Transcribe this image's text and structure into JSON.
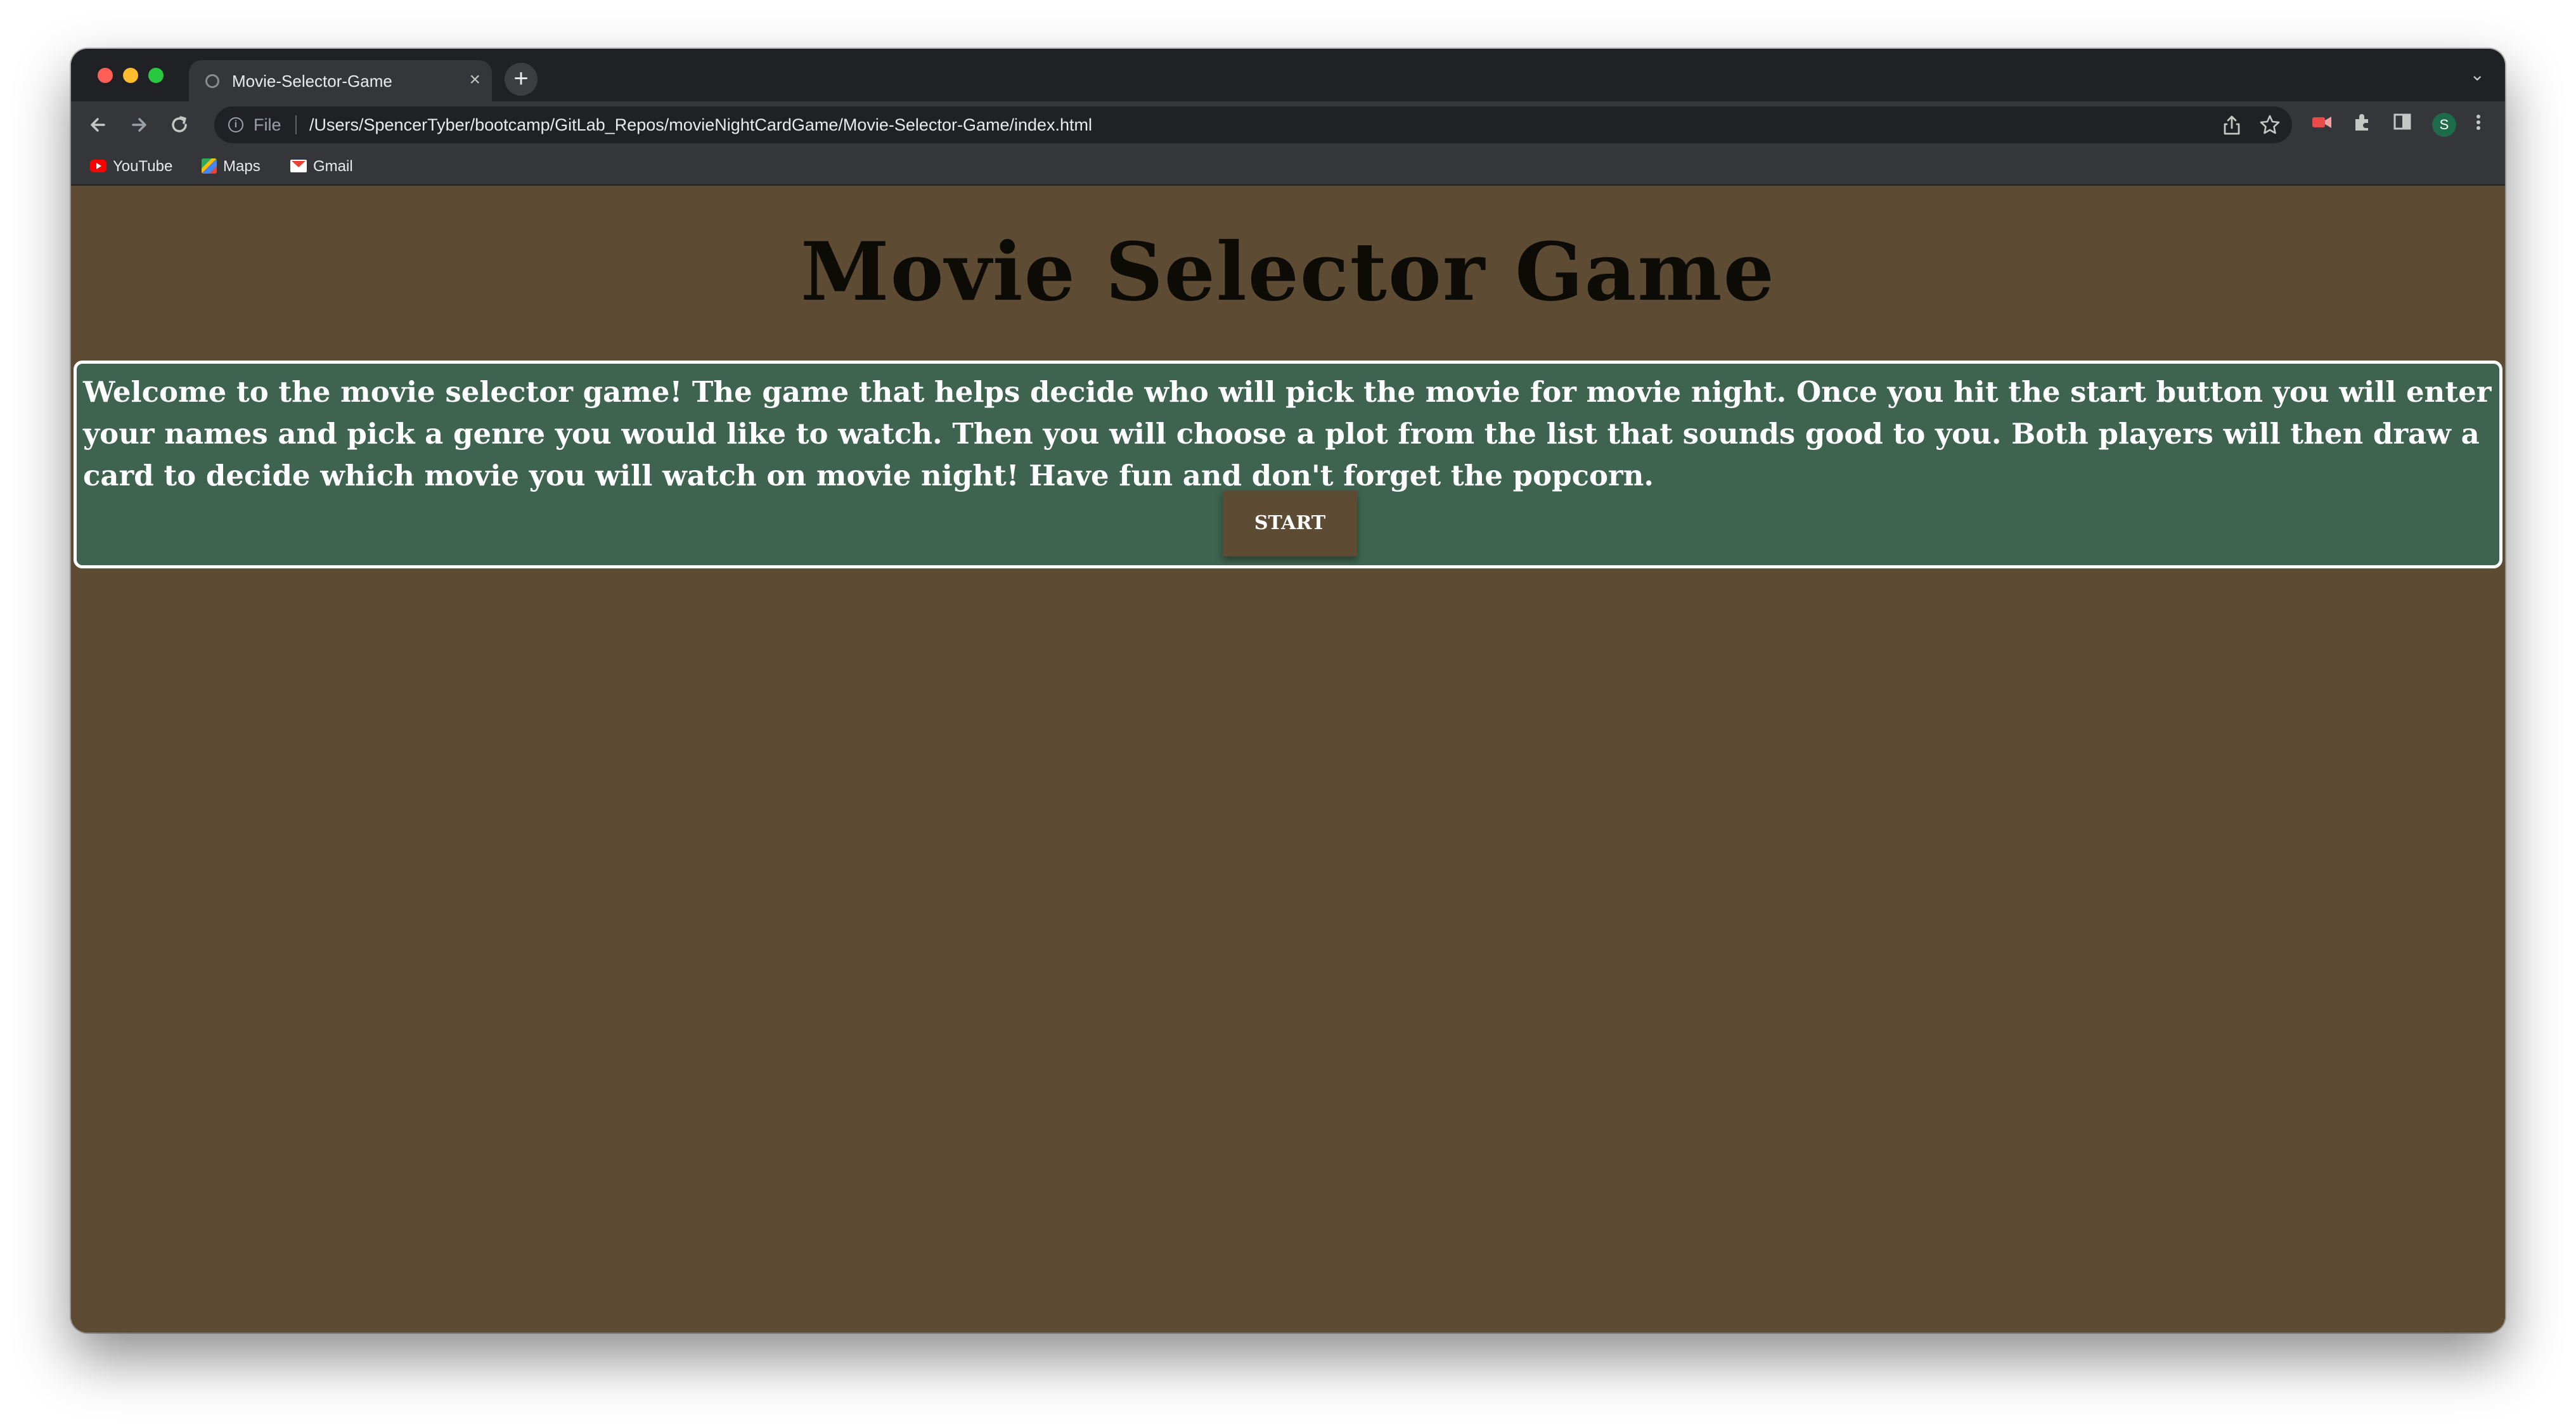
{
  "browser": {
    "tab_title": "Movie-Selector-Game",
    "tab_close": "×",
    "new_tab": "+",
    "tab_search": "⌄",
    "address": {
      "scheme": "File",
      "url": "/Users/SpencerTyber/bootcamp/GitLab_Repos/movieNightCardGame/Movie-Selector-Game/index.html"
    },
    "profile_initial": "S"
  },
  "bookmarks": [
    {
      "label": "YouTube",
      "icon": "youtube-icon"
    },
    {
      "label": "Maps",
      "icon": "maps-icon"
    },
    {
      "label": "Gmail",
      "icon": "gmail-icon"
    }
  ],
  "page": {
    "title": "Movie Selector Game",
    "intro": "Welcome to the movie selector game! The game that helps decide who will pick the movie for movie night. Once you hit the start button you will enter your names and pick a genre you would like to watch. Then you will choose a plot from the list that sounds good to you. Both players will then draw a card to decide which movie you will watch on movie night! Have fun and don't forget the popcorn.",
    "start_label": "START"
  },
  "colors": {
    "page_background": "#5e4b33",
    "intro_background": "#3e6350",
    "intro_border": "#ffffff",
    "title_text": "#0d0b06"
  }
}
